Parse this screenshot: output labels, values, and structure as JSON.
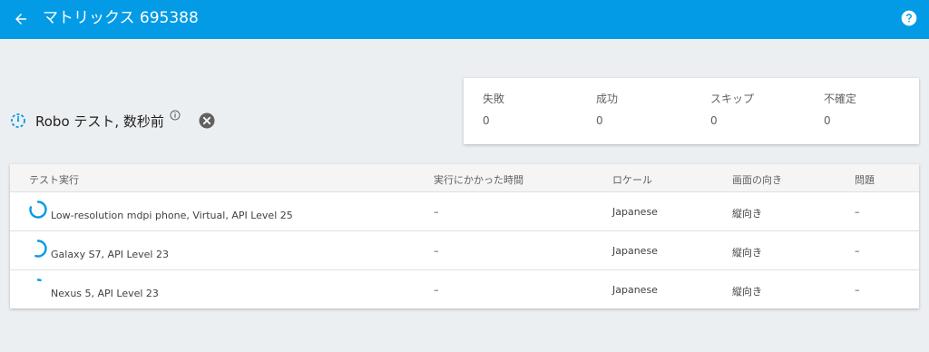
{
  "appbar": {
    "title": "マトリックス 695388",
    "back_icon": "arrow-left-icon",
    "help_icon": "help-circle-icon",
    "color": "#039be5"
  },
  "run": {
    "title": "Robo テスト, 数秒前",
    "status_icon": "in-progress-icon",
    "info_icon": "info-icon",
    "cancel_icon": "cancel-icon"
  },
  "summary": {
    "failed": {
      "label": "失敗",
      "value": "0"
    },
    "passed": {
      "label": "成功",
      "value": "0"
    },
    "skipped": {
      "label": "スキップ",
      "value": "0"
    },
    "inconclusive": {
      "label": "不確定",
      "value": "0"
    }
  },
  "table": {
    "headers": {
      "execution": "テスト実行",
      "duration": "実行にかかった時間",
      "locale": "ロケール",
      "orientation": "画面の向き",
      "issues": "問題"
    },
    "rows": [
      {
        "device": "Low-resolution mdpi phone, Virtual, API Level 25",
        "duration": "–",
        "locale": "Japanese",
        "orientation": "縦向き",
        "issues": "–",
        "progress": 0.8
      },
      {
        "device": "Galaxy S7, API Level 23",
        "duration": "–",
        "locale": "Japanese",
        "orientation": "縦向き",
        "issues": "–",
        "progress": 0.55
      },
      {
        "device": "Nexus 5, API Level 23",
        "duration": "–",
        "locale": "Japanese",
        "orientation": "縦向き",
        "issues": "–",
        "progress": 0.05
      }
    ]
  }
}
